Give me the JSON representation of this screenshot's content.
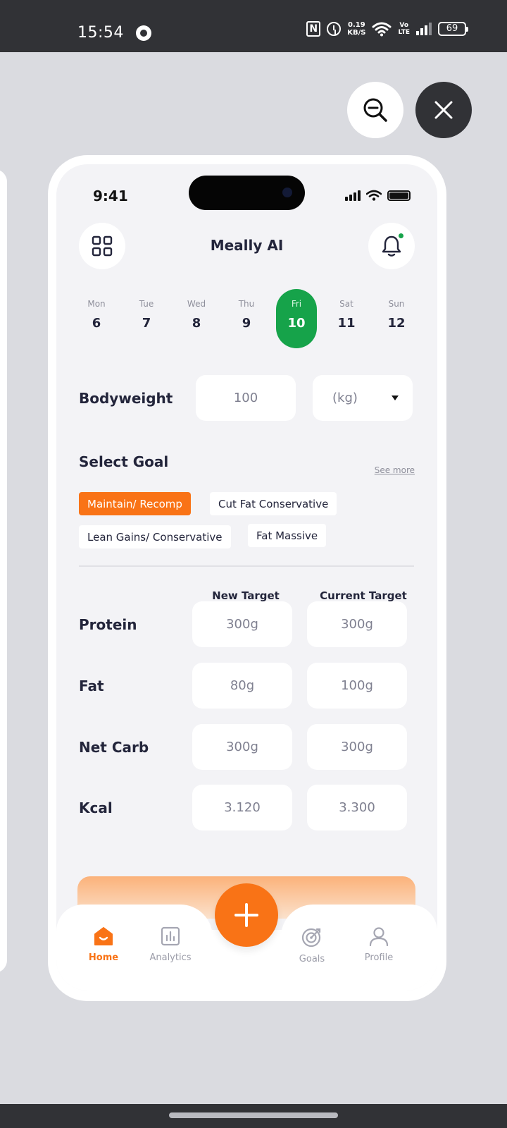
{
  "system_status": {
    "time": "15:54",
    "net_speed_value": "0.19",
    "net_speed_unit": "KB/S",
    "volte_top": "Vo",
    "volte_bottom": "LTE",
    "battery": "69",
    "nfc_symbol": "N"
  },
  "overlay": {
    "zoom_out_icon": "zoom-out-icon",
    "close_icon": "close-icon"
  },
  "phone_status": {
    "time": "9:41"
  },
  "header": {
    "title": "Meally AI",
    "menu_icon": "grid-icon",
    "bell_icon": "bell-icon"
  },
  "week": [
    {
      "day": "Mon",
      "date": "6"
    },
    {
      "day": "Tue",
      "date": "7"
    },
    {
      "day": "Wed",
      "date": "8"
    },
    {
      "day": "Thu",
      "date": "9"
    },
    {
      "day": "Fri",
      "date": "10"
    },
    {
      "day": "Sat",
      "date": "11"
    },
    {
      "day": "Sun",
      "date": "12"
    }
  ],
  "selected_day": "Fri",
  "bodyweight": {
    "label": "Bodyweight",
    "value": "100",
    "unit": "(kg)"
  },
  "goal": {
    "title": "Select Goal",
    "see_more": "See more",
    "options": [
      {
        "label": "Maintain/ Recomp",
        "selected": true
      },
      {
        "label": "Cut Fat Conservative",
        "selected": false
      },
      {
        "label": "Lean Gains/ Conservative",
        "selected": false
      },
      {
        "label": "Fat Massive",
        "selected": false
      }
    ]
  },
  "targets": {
    "new_header": "New Target",
    "current_header": "Current Target",
    "rows": [
      {
        "label": "Protein",
        "new": "300g",
        "current": "300g"
      },
      {
        "label": "Fat",
        "new": "80g",
        "current": "100g"
      },
      {
        "label": "Net Carb",
        "new": "300g",
        "current": "300g"
      },
      {
        "label": "Kcal",
        "new": "3.120",
        "current": "3.300"
      }
    ]
  },
  "tabbar": {
    "items": [
      {
        "label": "Home",
        "icon": "home-icon",
        "active": true
      },
      {
        "label": "Analytics",
        "icon": "analytics-icon",
        "active": false
      },
      {
        "label": "Goals",
        "icon": "goals-icon",
        "active": false
      },
      {
        "label": "Profile",
        "icon": "profile-icon",
        "active": false
      }
    ],
    "add_icon": "plus-icon"
  },
  "colors": {
    "accent_orange": "#f97316",
    "accent_green": "#16a34a",
    "text_dark": "#23253b",
    "background": "#f3f3f6"
  }
}
